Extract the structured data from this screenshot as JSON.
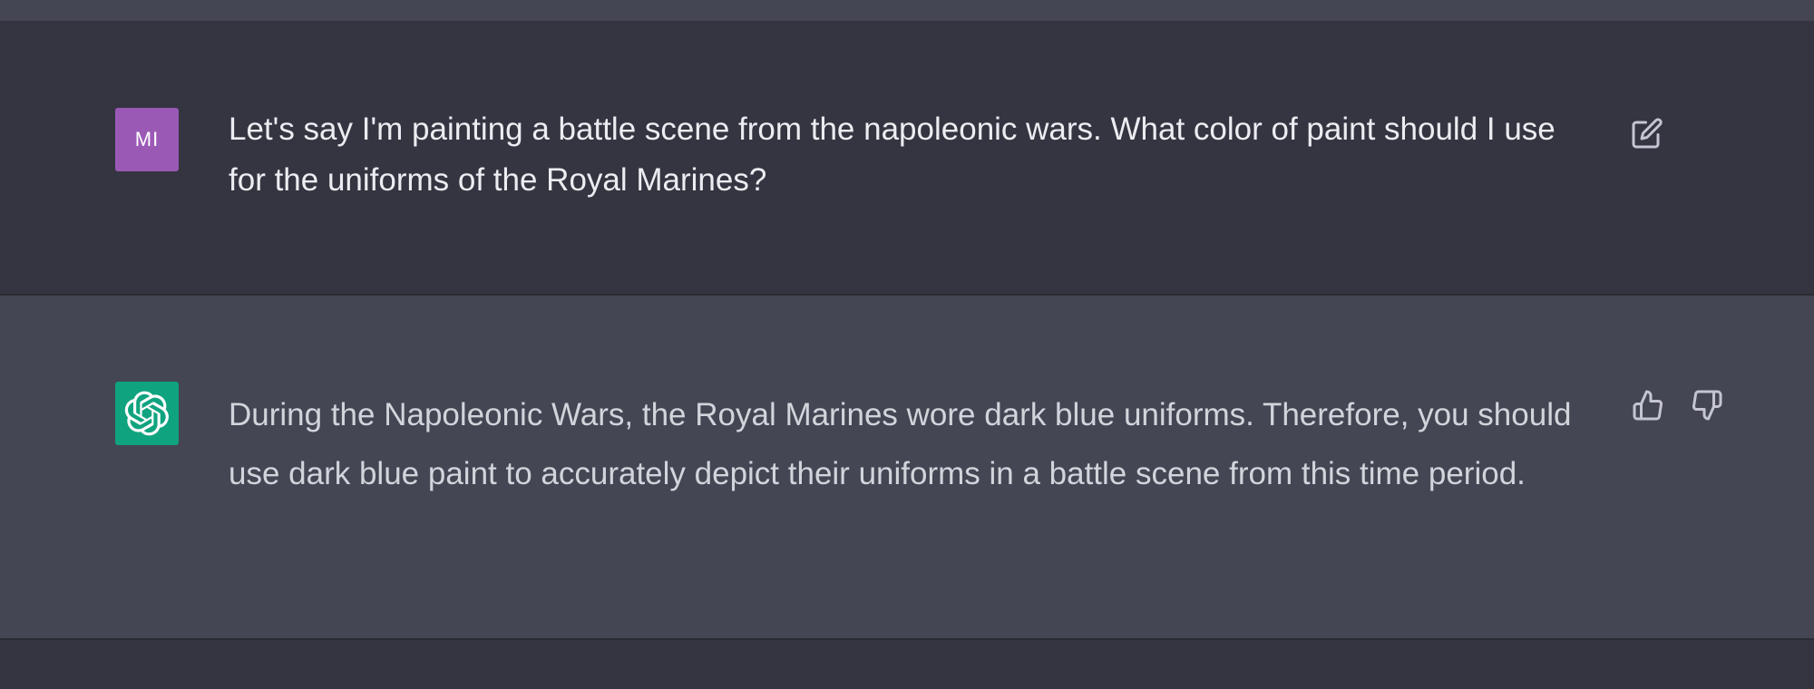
{
  "conversation": {
    "user_message": {
      "avatar_initials": "MI",
      "avatar_color": "#9b59b6",
      "text": "Let's say I'm painting a battle scene from the napoleonic wars. What color of paint should I use for the uniforms of the Royal Marines?",
      "edit_icon": "edit-icon"
    },
    "assistant_message": {
      "avatar_icon": "openai-logo-icon",
      "avatar_color": "#10a37f",
      "text": "During the Napoleonic Wars, the Royal Marines wore dark blue uniforms. Therefore, you should use dark blue paint to accurately depict their uniforms in a battle scene from this time period.",
      "like_icon": "thumbs-up-icon",
      "dislike_icon": "thumbs-down-icon"
    }
  },
  "colors": {
    "page_background": "#343541",
    "assistant_row_background": "#444654",
    "text": "#ececf1",
    "icon": "#c5c5d2"
  }
}
